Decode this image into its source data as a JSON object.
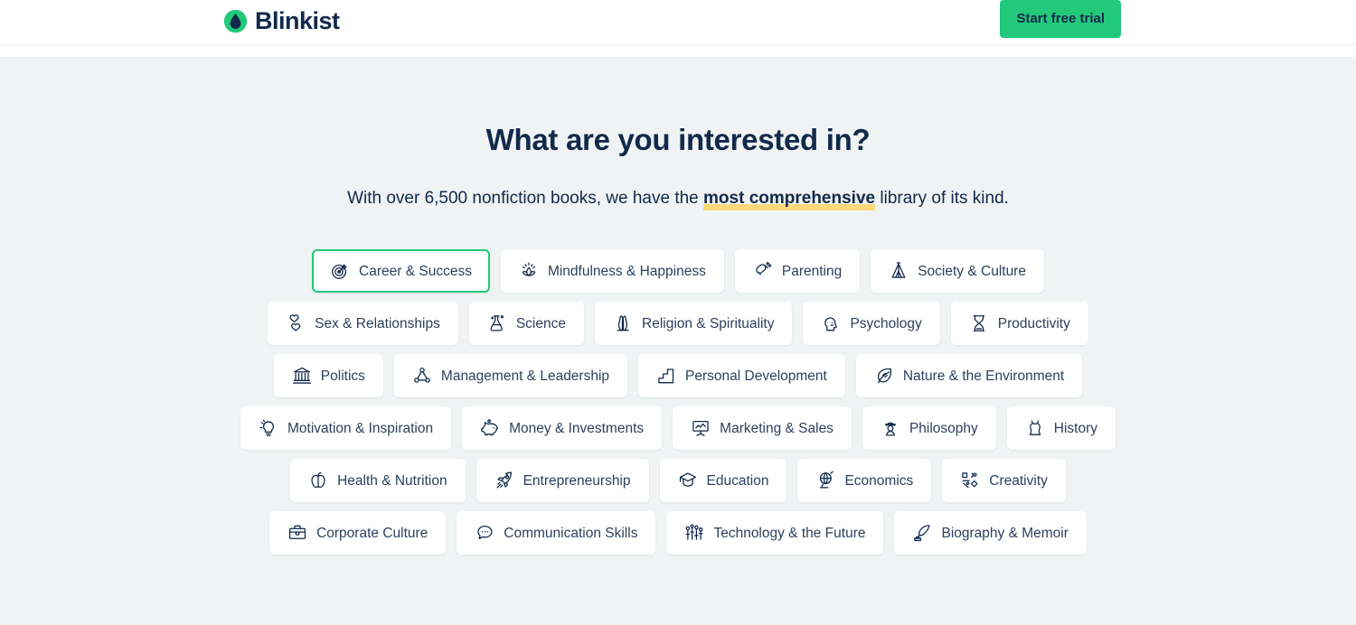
{
  "header": {
    "logo_text": "Blinkist",
    "logo_icon": "blinkist-droplet-logo",
    "cta_label": "Start free trial",
    "cta_color": "#22c97a"
  },
  "main": {
    "headline": "What are you interested in?",
    "subheadline_before": "With over 6,500 nonfiction books, we have the ",
    "subheadline_highlight": "most comprehensive",
    "subheadline_after": " library of its kind.",
    "highlight_color": "#fcd978",
    "background_color": "#eff3f3",
    "text_color": "#12294b"
  },
  "categories": {
    "selected": "Career & Success",
    "rows": [
      [
        {
          "label": "Career & Success",
          "icon": "target-icon",
          "selected": true
        },
        {
          "label": "Mindfulness & Happiness",
          "icon": "lotus-icon",
          "selected": false
        },
        {
          "label": "Parenting",
          "icon": "baby-bottle-icon",
          "selected": false
        },
        {
          "label": "Society & Culture",
          "icon": "teepee-icon",
          "selected": false
        }
      ],
      [
        {
          "label": "Sex & Relationships",
          "icon": "two-hearts-icon",
          "selected": false
        },
        {
          "label": "Science",
          "icon": "flask-icon",
          "selected": false
        },
        {
          "label": "Religion & Spirituality",
          "icon": "praying-hands-icon",
          "selected": false
        },
        {
          "label": "Psychology",
          "icon": "head-profile-icon",
          "selected": false
        },
        {
          "label": "Productivity",
          "icon": "hourglass-icon",
          "selected": false
        }
      ],
      [
        {
          "label": "Politics",
          "icon": "bank-building-icon",
          "selected": false
        },
        {
          "label": "Management & Leadership",
          "icon": "network-nodes-icon",
          "selected": false
        },
        {
          "label": "Personal Development",
          "icon": "stairs-icon",
          "selected": false
        },
        {
          "label": "Nature & the Environment",
          "icon": "leaf-icon",
          "selected": false
        }
      ],
      [
        {
          "label": "Motivation & Inspiration",
          "icon": "lightbulb-icon",
          "selected": false
        },
        {
          "label": "Money & Investments",
          "icon": "piggy-bank-icon",
          "selected": false
        },
        {
          "label": "Marketing & Sales",
          "icon": "presentation-chart-icon",
          "selected": false
        },
        {
          "label": "Philosophy",
          "icon": "laurel-person-icon",
          "selected": false
        },
        {
          "label": "History",
          "icon": "amphora-icon",
          "selected": false
        }
      ],
      [
        {
          "label": "Health & Nutrition",
          "icon": "apple-icon",
          "selected": false
        },
        {
          "label": "Entrepreneurship",
          "icon": "rocket-icon",
          "selected": false
        },
        {
          "label": "Education",
          "icon": "graduation-cap-icon",
          "selected": false
        },
        {
          "label": "Economics",
          "icon": "globe-stand-icon",
          "selected": false
        },
        {
          "label": "Creativity",
          "icon": "abstract-shapes-icon",
          "selected": false
        }
      ],
      [
        {
          "label": "Corporate Culture",
          "icon": "briefcase-icon",
          "selected": false
        },
        {
          "label": "Communication Skills",
          "icon": "speech-bubble-icon",
          "selected": false
        },
        {
          "label": "Technology & the Future",
          "icon": "circuit-icon",
          "selected": false
        },
        {
          "label": "Biography & Memoir",
          "icon": "quill-inkwell-icon",
          "selected": false
        }
      ]
    ]
  }
}
